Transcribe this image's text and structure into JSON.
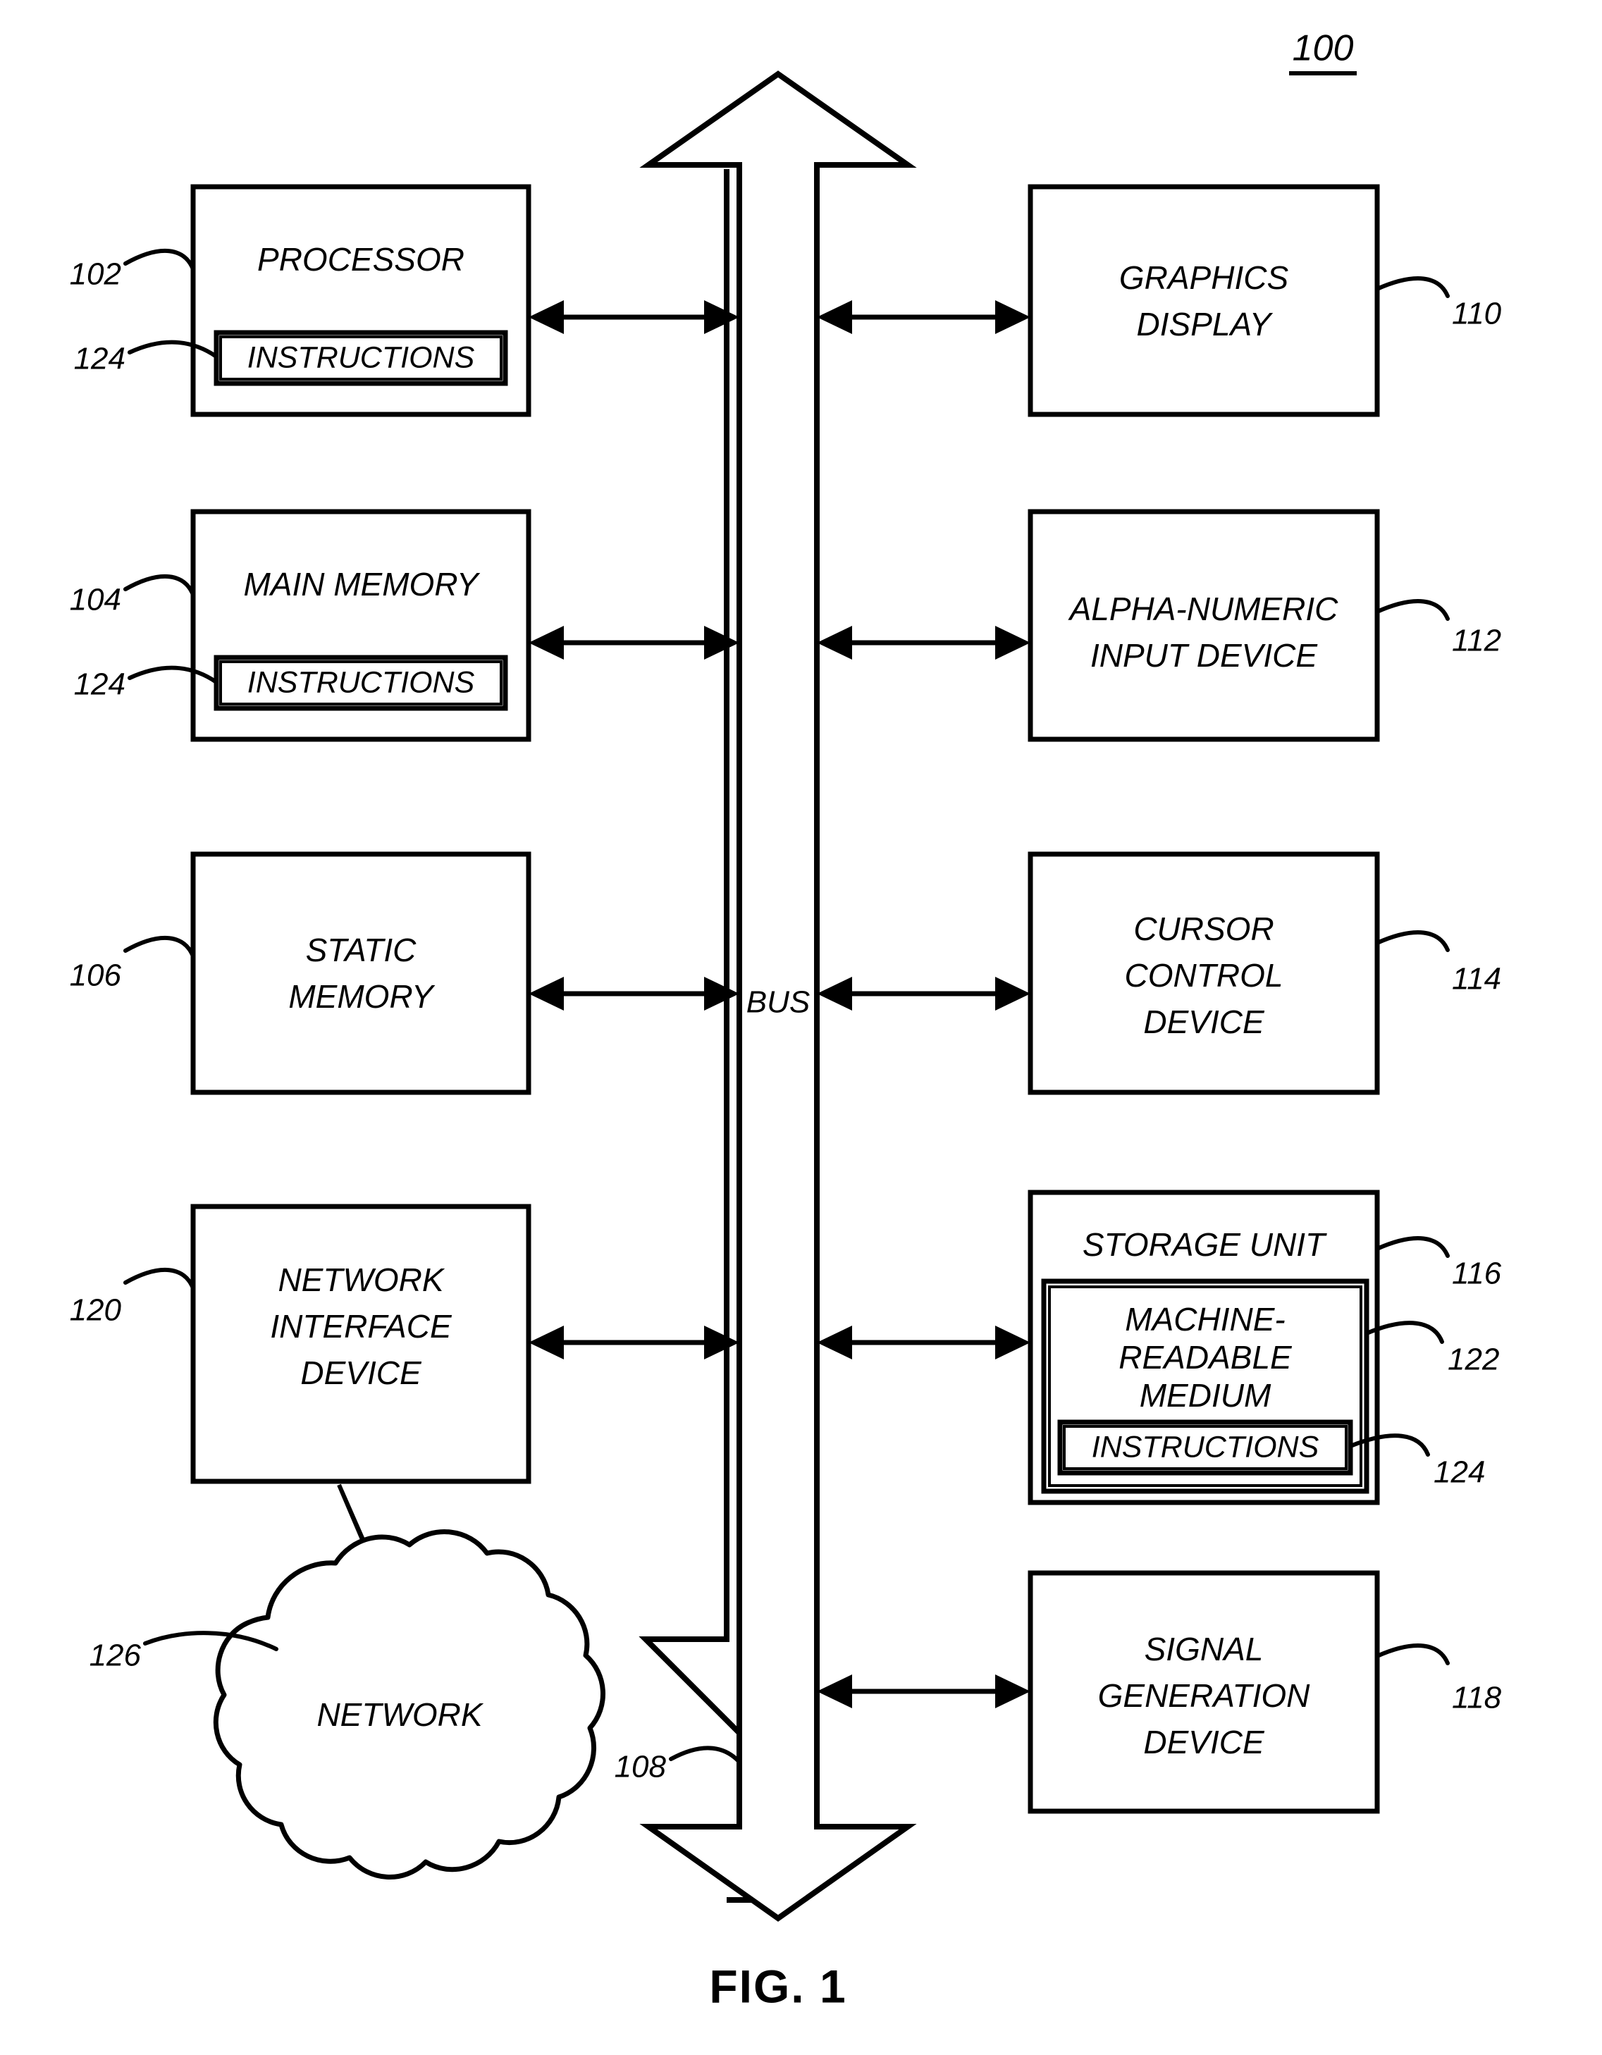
{
  "figure": {
    "number": "100",
    "caption": "FIG. 1",
    "bus_label": "BUS",
    "bus_ref": "108"
  },
  "left_column": [
    {
      "id": "processor",
      "title": "PROCESSOR",
      "ref": "102",
      "inner": {
        "title": "INSTRUCTIONS",
        "ref": "124"
      }
    },
    {
      "id": "main-memory",
      "title": "MAIN MEMORY",
      "ref": "104",
      "inner": {
        "title": "INSTRUCTIONS",
        "ref": "124"
      }
    },
    {
      "id": "static-memory",
      "title_line1": "STATIC",
      "title_line2": "MEMORY",
      "ref": "106"
    },
    {
      "id": "network-interface-device",
      "title_line1": "NETWORK",
      "title_line2": "INTERFACE",
      "title_line3": "DEVICE",
      "ref": "120"
    }
  ],
  "right_column": [
    {
      "id": "graphics-display",
      "title_line1": "GRAPHICS",
      "title_line2": "DISPLAY",
      "ref": "110"
    },
    {
      "id": "alpha-numeric-input-device",
      "title_line1": "ALPHA-NUMERIC",
      "title_line2": "INPUT DEVICE",
      "ref": "112"
    },
    {
      "id": "cursor-control-device",
      "title_line1": "CURSOR",
      "title_line2": "CONTROL",
      "title_line3": "DEVICE",
      "ref": "114"
    },
    {
      "id": "storage-unit",
      "title": "STORAGE UNIT",
      "ref": "116",
      "inner": {
        "title_line1": "MACHINE-",
        "title_line2": "READABLE",
        "title_line3": "MEDIUM",
        "ref": "122",
        "inner": {
          "title": "INSTRUCTIONS",
          "ref": "124"
        }
      }
    },
    {
      "id": "signal-generation-device",
      "title_line1": "SIGNAL",
      "title_line2": "GENERATION",
      "title_line3": "DEVICE",
      "ref": "118"
    }
  ],
  "network": {
    "id": "network-cloud",
    "title": "NETWORK",
    "ref": "126"
  },
  "colors": {
    "stroke": "#000000",
    "fill": "#ffffff"
  }
}
